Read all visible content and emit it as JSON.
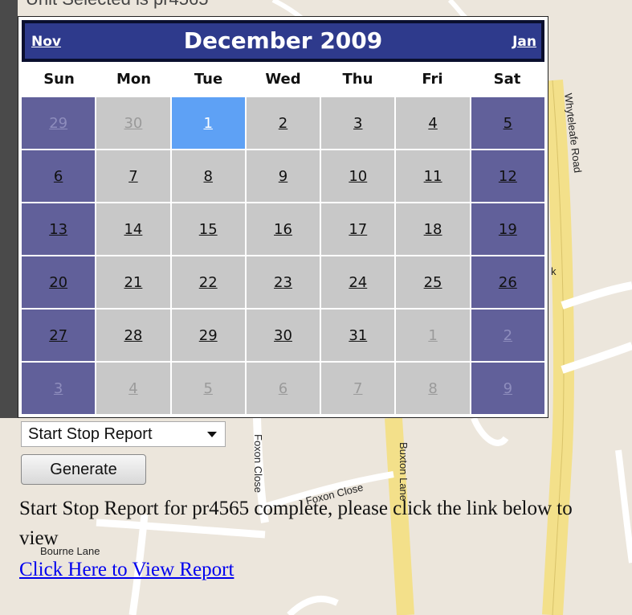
{
  "map": {
    "top_text": "Unit Selected is pr4565",
    "labels": {
      "whyteleafe_road": "Whyteleafe Road",
      "foxon_close_vertical": "Foxon Close",
      "foxon_close_horizontal": "Foxon Close",
      "buxton_lane": "Buxton Lane",
      "bourne_lane": "Bourne Lane",
      "fragment_k": "k"
    }
  },
  "calendar": {
    "prev_label": "Nov",
    "title": "December 2009",
    "next_label": "Jan",
    "weekdays": [
      "Sun",
      "Mon",
      "Tue",
      "Wed",
      "Thu",
      "Fri",
      "Sat"
    ],
    "weeks": [
      [
        "29",
        "30",
        "1",
        "2",
        "3",
        "4",
        "5"
      ],
      [
        "6",
        "7",
        "8",
        "9",
        "10",
        "11",
        "12"
      ],
      [
        "13",
        "14",
        "15",
        "16",
        "17",
        "18",
        "19"
      ],
      [
        "20",
        "21",
        "22",
        "23",
        "24",
        "25",
        "26"
      ],
      [
        "27",
        "28",
        "29",
        "30",
        "31",
        "1",
        "2"
      ],
      [
        "3",
        "4",
        "5",
        "6",
        "7",
        "8",
        "9"
      ]
    ],
    "selected_day": "1",
    "colors": {
      "header_bg": "#2e3a8c",
      "weekday_cell": "#c8c8c8",
      "weekend_cell": "#61609a",
      "selected_cell": "#5ea1f5"
    }
  },
  "report": {
    "select_value": "Start Stop Report",
    "generate_label": "Generate",
    "status_message": "Start Stop Report for pr4565 complete, please click the link below to view",
    "link_text": "Click Here to View Report"
  }
}
